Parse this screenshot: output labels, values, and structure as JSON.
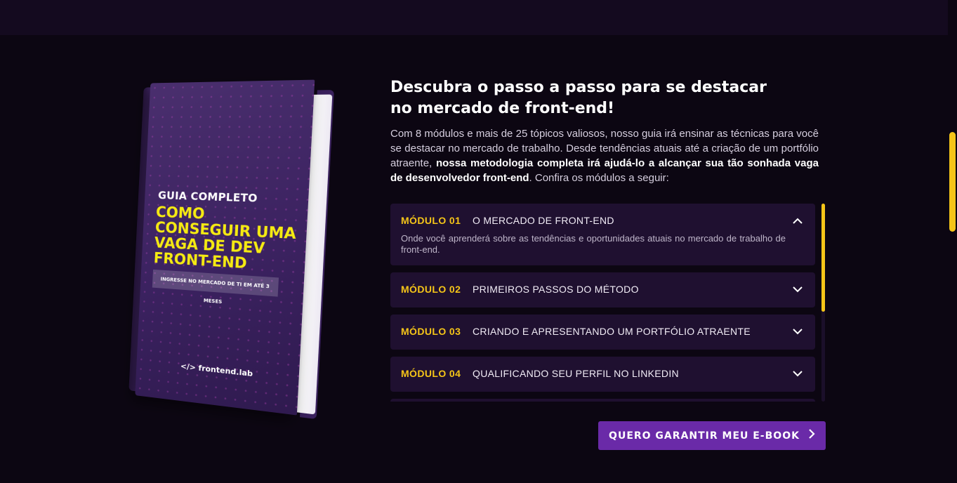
{
  "colors": {
    "background": "#0c0612",
    "accent": "#f5c518",
    "card": "#1f1030",
    "button": "#6a2aa8"
  },
  "book": {
    "kicker": "GUIA COMPLETO",
    "title": "COMO CONSEGUIR UMA VAGA DE DEV FRONT-END",
    "ribbon": "INGRESSE NO MERCADO DE TI EM ATÉ 3 MESES",
    "brand": "</> frontend.lab"
  },
  "section": {
    "headline": "Descubra o passo a passo para se destacar no mercado de front-end!",
    "intro_part1": "Com 8 módulos e mais de 25 tópicos valiosos, nosso guia irá ensinar as técnicas para você se destacar no mercado de trabalho. Desde tendências atuais até a criação de um portfólio atraente, ",
    "intro_bold": "nossa metodologia completa irá ajudá-lo a alcançar sua tão sonhada vaga de desenvolvedor front-end",
    "intro_part2": ". Confira os módulos a seguir:"
  },
  "modules": [
    {
      "number": "MÓDULO 01",
      "title": "O MERCADO DE FRONT-END",
      "description": "Onde você aprenderá sobre as tendências e oportunidades atuais no mercado de trabalho de front-end.",
      "expanded": true,
      "icon": "chevron-up-icon"
    },
    {
      "number": "MÓDULO 02",
      "title": "PRIMEIROS PASSOS DO MÉTODO",
      "expanded": false,
      "icon": "chevron-down-icon"
    },
    {
      "number": "MÓDULO 03",
      "title": "CRIANDO E APRESENTANDO UM PORTFÓLIO ATRAENTE",
      "expanded": false,
      "icon": "chevron-down-icon"
    },
    {
      "number": "MÓDULO 04",
      "title": "QUALIFICANDO SEU PERFIL NO LINKEDIN",
      "expanded": false,
      "icon": "chevron-down-icon"
    }
  ],
  "cta": {
    "label": "QUERO GARANTIR MEU E-BOOK",
    "icon": "chevron-right-icon"
  }
}
